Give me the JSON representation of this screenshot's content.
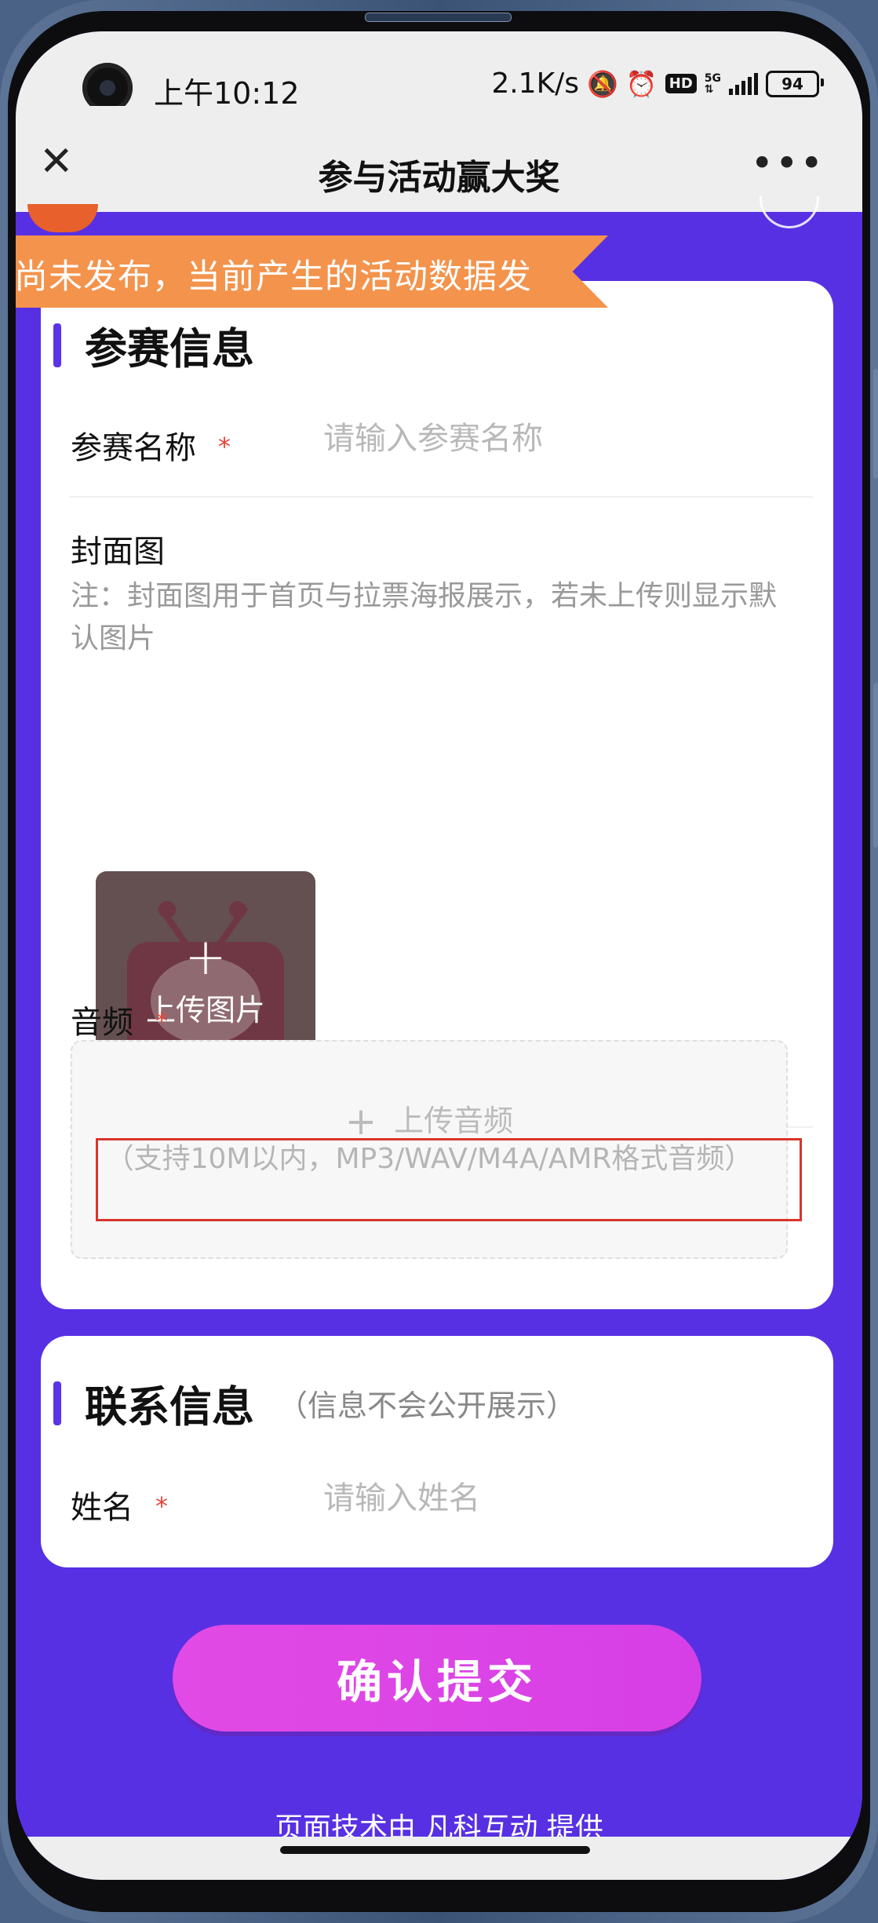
{
  "status_bar": {
    "time": "上午10:12",
    "net_speed": "2.1K/s",
    "hd": "HD",
    "network": "5G",
    "battery": "94"
  },
  "nav": {
    "close_icon": "✕",
    "title": "参与活动赢大奖",
    "more_icon": "•••"
  },
  "banner": {
    "text": "尚未发布，当前产生的活动数据发"
  },
  "entry_section": {
    "title": "参赛信息",
    "name_label": "参赛名称",
    "required_mark": "*",
    "name_placeholder": "请输入参赛名称",
    "cover_label": "封面图",
    "cover_note": "注：封面图用于首页与拉票海报展示，若未上传则显示默认图片",
    "upload_image_plus": "+",
    "upload_image_label": "上传图片",
    "audio_label": "音频",
    "upload_audio_plus": "+",
    "upload_audio_label": "上传音频",
    "audio_hint": "（支持10M以内，MP3/WAV/M4A/AMR格式音频）"
  },
  "contact_section": {
    "title": "联系信息",
    "note": "（信息不会公开展示）",
    "name_label": "姓名",
    "required_mark": "*",
    "name_placeholder": "请输入姓名"
  },
  "submit": {
    "label": "确认提交"
  },
  "footer": {
    "text": "页面技术由 凡科互动 提供"
  },
  "colors": {
    "page_background": "#5730e3",
    "accent": "#5a34e6",
    "submit_button": "#e24ae5",
    "banner": "#f3934c",
    "required": "#e8453c",
    "highlight": "#d9342b"
  }
}
